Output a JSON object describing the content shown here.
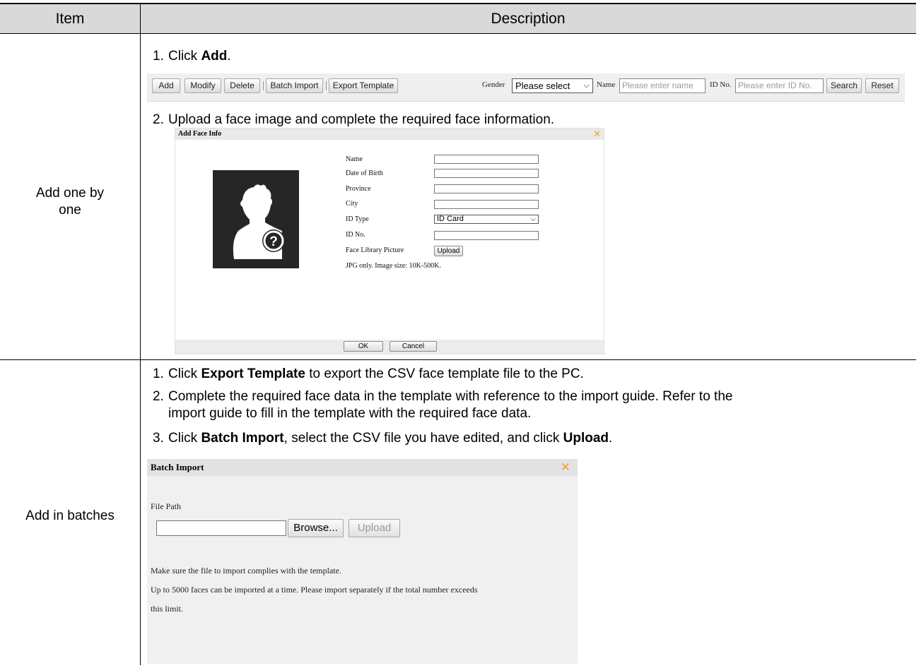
{
  "table": {
    "header": {
      "item": "Item",
      "description": "Description"
    },
    "rows": [
      {
        "item": "Add one by one",
        "steps": [
          {
            "num": "1.",
            "pre": "Click ",
            "bold": "Add",
            "post": "."
          },
          {
            "num": "2.",
            "pre": "Upload a face image and complete the required face information.",
            "bold": "",
            "post": ""
          }
        ]
      },
      {
        "item": "Add in batches",
        "steps": [
          {
            "num": "1.",
            "pre": "Click ",
            "bold": "Export Template",
            "post": " to export the CSV face template file to the PC."
          },
          {
            "num": "2.",
            "line1": "Complete the required face data in the template with reference to the import guide. Refer to the",
            "line2": "import guide to fill in the template with the required face data."
          },
          {
            "num": "3.",
            "pre": "Click ",
            "bold": "Batch Import",
            "mid": ", select the CSV file you have edited, and click ",
            "bold2": "Upload",
            "post": "."
          }
        ]
      }
    ]
  },
  "toolbar": {
    "buttons": [
      "Add",
      "Modify",
      "Delete",
      "Batch Import",
      "Export Template"
    ],
    "gender_label": "Gender",
    "gender_value": "Please select",
    "name_label": "Name",
    "name_placeholder": "Please enter name",
    "id_label": "ID No.",
    "id_placeholder": "Please enter ID No.",
    "search": "Search",
    "reset": "Reset"
  },
  "add_face_dialog": {
    "title": "Add Face Info",
    "close_icon": "close-icon",
    "fields": {
      "name": "Name",
      "dob": "Date of Birth",
      "province": "Province",
      "city": "City",
      "id_type": "ID Type",
      "id_type_value": "ID Card",
      "id_no": "ID No.",
      "picture": "Face Library Picture",
      "upload": "Upload"
    },
    "note": "JPG only. Image size: 10K-500K.",
    "ok": "OK",
    "cancel": "Cancel"
  },
  "batch_dialog": {
    "title": "Batch Import",
    "file_path_label": "File Path",
    "browse": "Browse...",
    "upload": "Upload",
    "note1": "Make sure the file to import complies with the template.",
    "note2": "Up to 5000 faces can be imported at a time. Please import separately if the total number exceeds",
    "note3": "this limit."
  },
  "colors": {
    "header_bg": "#d9d9d9",
    "close_accent": "#f0a030",
    "avatar_bg": "#262626"
  }
}
